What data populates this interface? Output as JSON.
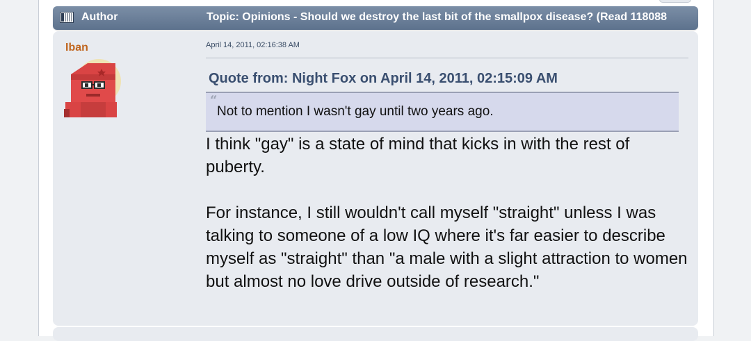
{
  "header": {
    "author_label": "Author",
    "topic_title": "Topic: Opinions - Should we destroy the last bit of the smallpox disease?  (Read 118088"
  },
  "post": {
    "author_name": "Iban",
    "date": "April 14, 2011, 02:16:38 AM",
    "quote": {
      "header": "Quote from: Night Fox on April 14, 2011, 02:15:09 AM",
      "text": "Not to mention I wasn't gay until two years ago."
    },
    "body": [
      "I think \"gay\" is a state of mind that kicks in with the rest of puberty.",
      "For instance, I still wouldn't call myself \"straight\" unless I was talking to someone of a low IQ where it's far easier to describe myself as \"straight\" than \"a male with a slight attraction to women but almost no love drive outside of research.\""
    ]
  },
  "icons": {
    "header_icon": "topic-board-icon",
    "avatar": "red-robot-avatar"
  },
  "colors": {
    "header_bar": "#6a7e98",
    "post_background": "#e8ebf0",
    "author_name": "#c0661f",
    "quote_header": "#3a4f70",
    "quote_background": "#d6d9ec"
  }
}
